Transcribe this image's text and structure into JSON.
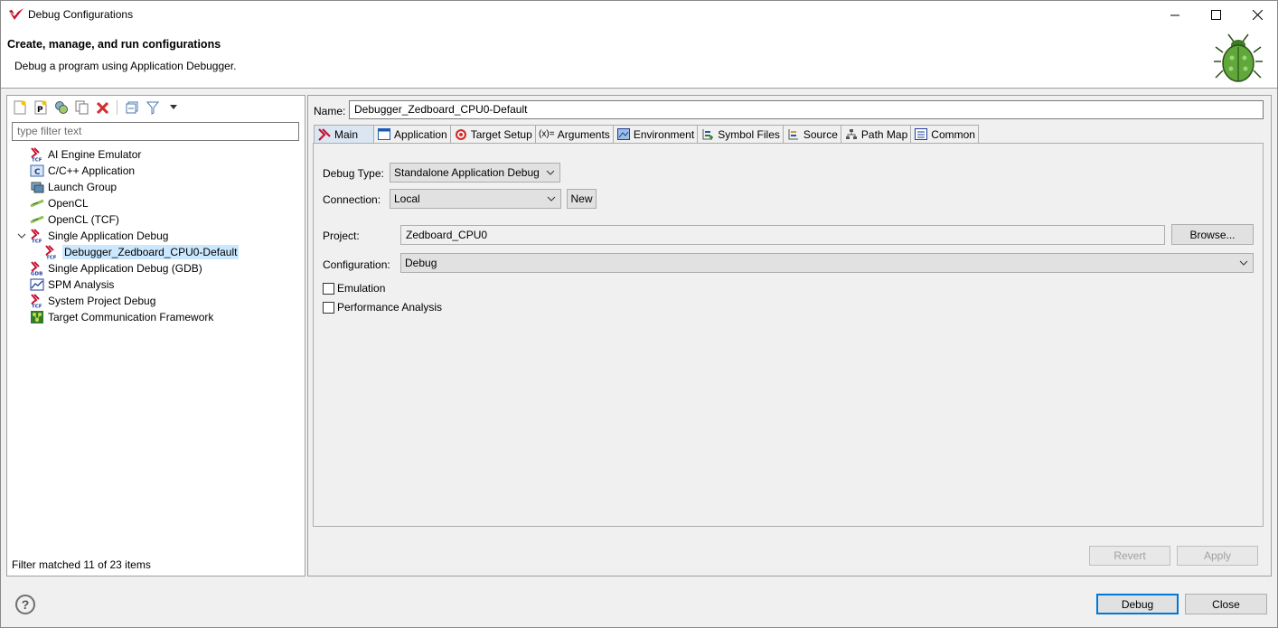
{
  "window": {
    "title": "Debug Configurations",
    "controls": [
      "minimize-icon",
      "maximize-icon",
      "close-icon"
    ]
  },
  "banner": {
    "heading": "Create, manage, and run configurations",
    "subtitle": "Debug a program using Application Debugger.",
    "icon": "bug-icon"
  },
  "left": {
    "toolbar": [
      "new-config-icon",
      "new-prototype-icon",
      "export-icon",
      "duplicate-icon",
      "delete-icon",
      "collapse-all-icon",
      "filter-icon",
      "dropdown-arrow-icon"
    ],
    "filter_placeholder": "type filter text",
    "tree": [
      {
        "label": "AI Engine Emulator",
        "icon": "tcf-icon"
      },
      {
        "label": "C/C++ Application",
        "icon": "c-icon"
      },
      {
        "label": "Launch Group",
        "icon": "launch-group-icon"
      },
      {
        "label": "OpenCL",
        "icon": "opencl-icon"
      },
      {
        "label": "OpenCL (TCF)",
        "icon": "opencl-icon"
      },
      {
        "label": "Single Application Debug",
        "icon": "tcf-icon",
        "expanded": true
      },
      {
        "label": "Debugger_Zedboard_CPU0-Default",
        "icon": "tcf-icon",
        "selected": true
      },
      {
        "label": "Single Application Debug (GDB)",
        "icon": "gdb-icon"
      },
      {
        "label": "SPM Analysis",
        "icon": "spm-icon"
      },
      {
        "label": "System Project Debug",
        "icon": "tcf-icon"
      },
      {
        "label": "Target Communication Framework",
        "icon": "tcf-green-icon"
      }
    ],
    "status": "Filter matched 11 of 23 items"
  },
  "right": {
    "name_label": "Name:",
    "name_value": "Debugger_Zedboard_CPU0-Default",
    "tabs": [
      {
        "label": "Main",
        "icon": "xilinx-icon",
        "active": true
      },
      {
        "label": "Application",
        "icon": "window-icon"
      },
      {
        "label": "Target Setup",
        "icon": "target-icon"
      },
      {
        "label": "Arguments",
        "icon": "variable-icon"
      },
      {
        "label": "Environment",
        "icon": "environment-icon"
      },
      {
        "label": "Symbol Files",
        "icon": "symbol-files-icon"
      },
      {
        "label": "Source",
        "icon": "source-icon"
      },
      {
        "label": "Path Map",
        "icon": "path-map-icon"
      },
      {
        "label": "Common",
        "icon": "common-icon"
      }
    ],
    "main": {
      "debug_type_label": "Debug Type:",
      "debug_type_value": "Standalone Application Debug",
      "connection_label": "Connection:",
      "connection_value": "Local",
      "new_button": "New",
      "project_label": "Project:",
      "project_value": "Zedboard_CPU0",
      "browse_button": "Browse...",
      "configuration_label": "Configuration:",
      "configuration_value": "Debug",
      "emulation_label": "Emulation",
      "emulation_checked": false,
      "perf_label": "Performance Analysis",
      "perf_checked": false
    },
    "revert_button": "Revert",
    "apply_button": "Apply"
  },
  "footer": {
    "debug_button": "Debug",
    "close_button": "Close",
    "help_icon": "help-icon",
    "help_glyph": "?"
  },
  "colors": {
    "selection": "#cce8ff",
    "accent": "#0078d7",
    "delete_red": "#d32f2f"
  }
}
